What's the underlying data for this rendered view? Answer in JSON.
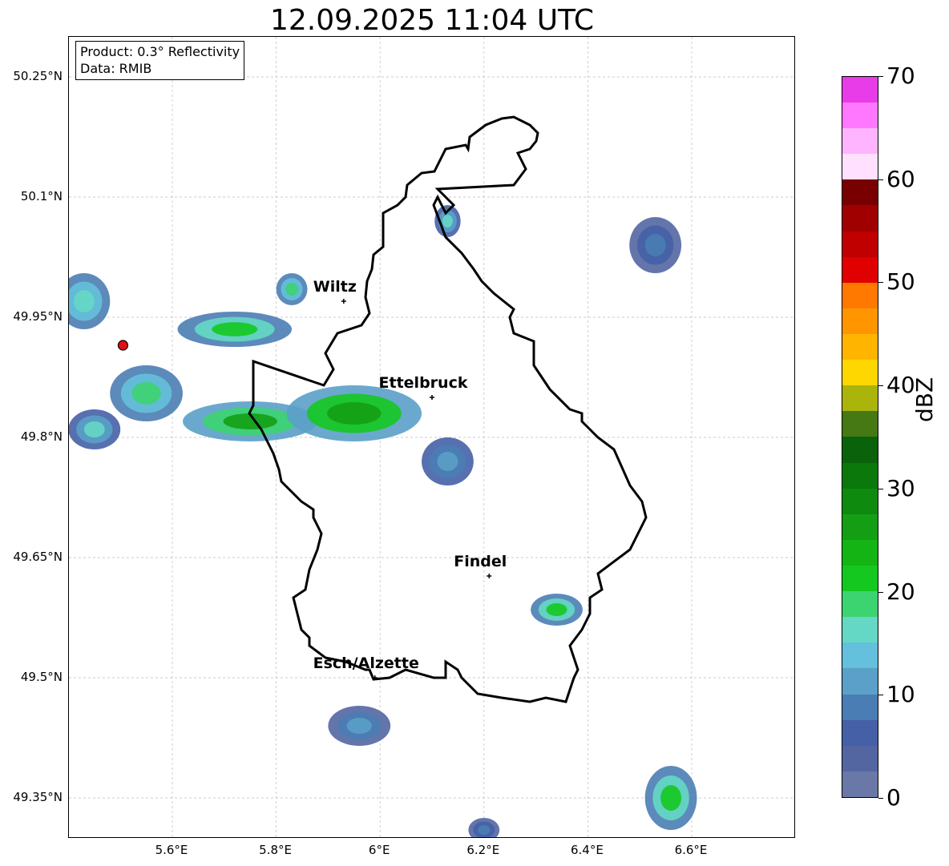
{
  "title": "12.09.2025 11:04 UTC",
  "info_box": {
    "product": "Product: 0.3° Reflectivity",
    "data_source": "Data: RMIB"
  },
  "map": {
    "lat_ticks": [
      {
        "label": "50.25°N",
        "value": 50.25
      },
      {
        "label": "50.1°N",
        "value": 50.1
      },
      {
        "label": "49.95°N",
        "value": 49.95
      },
      {
        "label": "49.8°N",
        "value": 49.8
      },
      {
        "label": "49.65°N",
        "value": 49.65
      },
      {
        "label": "49.5°N",
        "value": 49.5
      },
      {
        "label": "49.35°N",
        "value": 49.35
      }
    ],
    "lon_ticks": [
      {
        "label": "5.6°E",
        "value": 5.6
      },
      {
        "label": "5.8°E",
        "value": 5.8
      },
      {
        "label": "6°E",
        "value": 6.0
      },
      {
        "label": "6.2°E",
        "value": 6.2
      },
      {
        "label": "6.4°E",
        "value": 6.4
      },
      {
        "label": "6.6°E",
        "value": 6.6
      }
    ],
    "lon_range": [
      5.4,
      6.8
    ],
    "lat_range": [
      49.3,
      50.3
    ],
    "cities": [
      {
        "name": "Wiltz",
        "lon": 5.93,
        "lat": 49.97
      },
      {
        "name": "Ettelbruck",
        "lon": 6.1,
        "lat": 49.85
      },
      {
        "name": "Findel",
        "lon": 6.21,
        "lat": 49.627
      },
      {
        "name": "Esch/Alzette",
        "lon": 5.99,
        "lat": 49.5
      }
    ],
    "radar_site": {
      "lon": 5.505,
      "lat": 49.915,
      "color": "#e01010"
    },
    "echo_cells": [
      {
        "lon": 5.43,
        "lat": 49.97,
        "rx": 0.05,
        "ry": 0.035,
        "dbz": 17
      },
      {
        "lon": 5.72,
        "lat": 49.935,
        "rx": 0.11,
        "ry": 0.022,
        "dbz": 22
      },
      {
        "lon": 5.55,
        "lat": 49.855,
        "rx": 0.07,
        "ry": 0.035,
        "dbz": 19
      },
      {
        "lon": 5.45,
        "lat": 49.81,
        "rx": 0.05,
        "ry": 0.025,
        "dbz": 15
      },
      {
        "lon": 5.75,
        "lat": 49.82,
        "rx": 0.13,
        "ry": 0.025,
        "dbz": 25
      },
      {
        "lon": 5.95,
        "lat": 49.83,
        "rx": 0.13,
        "ry": 0.035,
        "dbz": 27
      },
      {
        "lon": 5.83,
        "lat": 49.985,
        "rx": 0.03,
        "ry": 0.02,
        "dbz": 18
      },
      {
        "lon": 6.13,
        "lat": 49.77,
        "rx": 0.05,
        "ry": 0.03,
        "dbz": 12
      },
      {
        "lon": 6.13,
        "lat": 50.07,
        "rx": 0.025,
        "ry": 0.02,
        "dbz": 16
      },
      {
        "lon": 6.53,
        "lat": 50.04,
        "rx": 0.05,
        "ry": 0.035,
        "dbz": 8
      },
      {
        "lon": 6.34,
        "lat": 49.585,
        "rx": 0.05,
        "ry": 0.02,
        "dbz": 20
      },
      {
        "lon": 5.96,
        "lat": 49.44,
        "rx": 0.06,
        "ry": 0.025,
        "dbz": 10
      },
      {
        "lon": 6.56,
        "lat": 49.35,
        "rx": 0.05,
        "ry": 0.04,
        "dbz": 22
      },
      {
        "lon": 6.2,
        "lat": 49.31,
        "rx": 0.03,
        "ry": 0.015,
        "dbz": 8
      }
    ]
  },
  "colorbar": {
    "label": "dBZ",
    "min": 0,
    "max": 70,
    "ticks": [
      {
        "label": "0",
        "value": 0
      },
      {
        "label": "10",
        "value": 10
      },
      {
        "label": "20",
        "value": 20
      },
      {
        "label": "30",
        "value": 30
      },
      {
        "label": "40",
        "value": 40
      },
      {
        "label": "50",
        "value": 50
      },
      {
        "label": "60",
        "value": 60
      },
      {
        "label": "70",
        "value": 70
      }
    ],
    "colors": [
      "#6a78a8",
      "#5366a2",
      "#4560a6",
      "#4a7db4",
      "#5aa0c8",
      "#64c0dc",
      "#64d8c4",
      "#3cd470",
      "#14c820",
      "#14b414",
      "#149e14",
      "#0e8a0e",
      "#0a780a",
      "#0a620a",
      "#467814",
      "#aab40a",
      "#ffd700",
      "#ffb400",
      "#ff9600",
      "#ff7800",
      "#e00000",
      "#c00000",
      "#a00000",
      "#780000",
      "#ffe0ff",
      "#ffb4ff",
      "#ff78ff",
      "#e83ce8"
    ]
  }
}
